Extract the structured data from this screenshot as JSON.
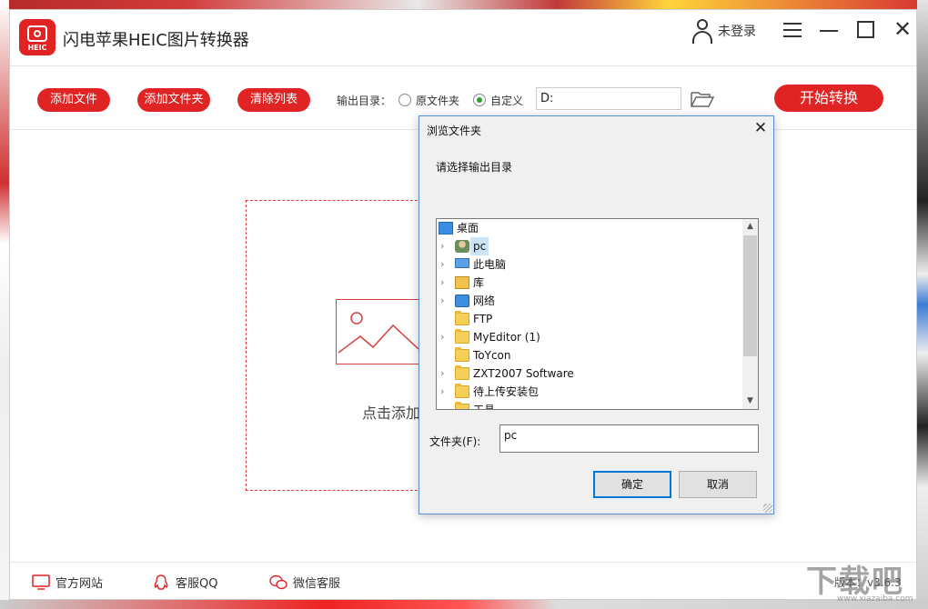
{
  "app": {
    "logo_text": "HEIC",
    "title": "闪电苹果HEIC图片转换器",
    "user_label": "未登录",
    "brand_color": "#e02424"
  },
  "window_controls": [
    "menu-icon",
    "minimize-icon",
    "maximize-icon",
    "close-icon"
  ],
  "toolbar": {
    "add_file": "添加文件",
    "add_folder": "添加文件夹",
    "clear_list": "清除列表",
    "output_label": "输出目录：",
    "radio_original": "原文件夹",
    "radio_custom": "自定义",
    "selected_radio": "自定义",
    "output_path": "D:",
    "start_convert": "开始转换"
  },
  "dropzone": {
    "text": "点击添加"
  },
  "footer": {
    "website": "官方网站",
    "qq": "客服QQ",
    "wechat": "微信客服",
    "version": "版本：v3.6.3"
  },
  "dialog": {
    "title": "浏览文件夹",
    "prompt": "请选择输出目录",
    "tree": [
      {
        "label": "桌面",
        "icon": "desktop-icon",
        "expandable": false
      },
      {
        "label": "pc",
        "icon": "user-icon",
        "expandable": true,
        "selected": true
      },
      {
        "label": "此电脑",
        "icon": "computer-icon",
        "expandable": true
      },
      {
        "label": "库",
        "icon": "library-icon",
        "expandable": true
      },
      {
        "label": "网络",
        "icon": "network-icon",
        "expandable": true
      },
      {
        "label": "FTP",
        "icon": "folder-icon",
        "expandable": false
      },
      {
        "label": "MyEditor (1)",
        "icon": "folder-icon",
        "expandable": true
      },
      {
        "label": "ToYcon",
        "icon": "folder-icon",
        "expandable": false
      },
      {
        "label": "ZXT2007 Software",
        "icon": "folder-icon",
        "expandable": true
      },
      {
        "label": "待上传安装包",
        "icon": "folder-icon",
        "expandable": true
      },
      {
        "label": "工具",
        "icon": "folder-icon",
        "expandable": false
      }
    ],
    "folder_label": "文件夹(F):",
    "folder_value": "pc",
    "ok": "确定",
    "cancel": "取消"
  },
  "watermark": {
    "big": "下载吧",
    "small": "www.xiazaiba.com"
  }
}
